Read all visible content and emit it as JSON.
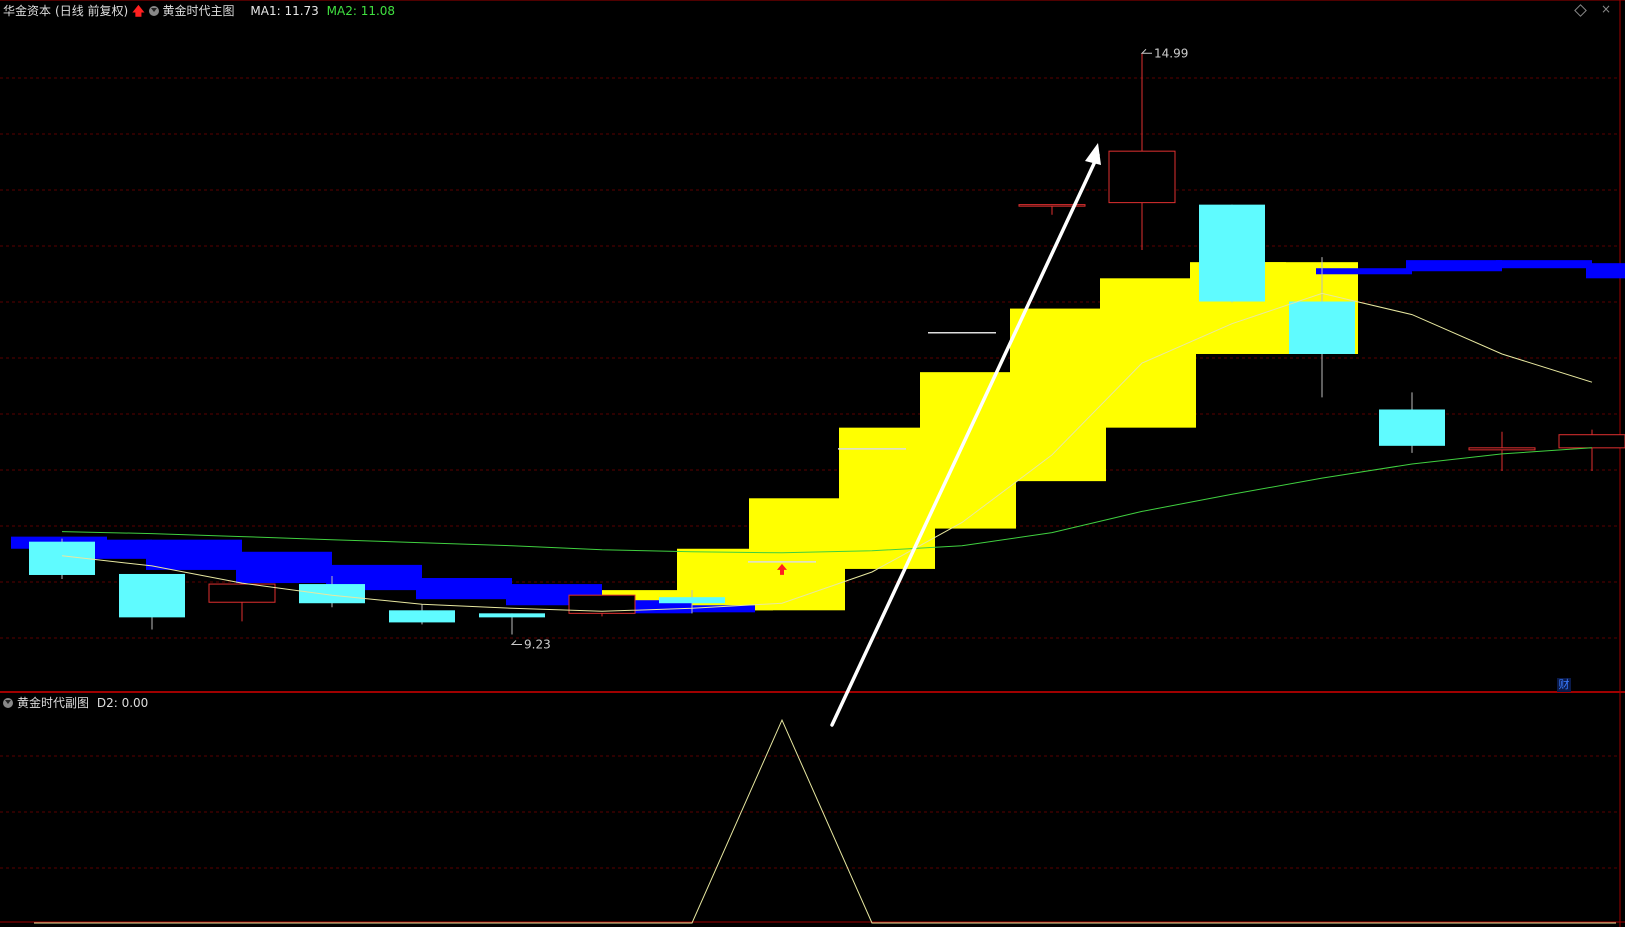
{
  "header": {
    "stock_name": "华金资本",
    "period_label": "(日线 前复权)",
    "main_indicator": "黄金时代主图",
    "ma1_label": "MA1: 11.73",
    "ma2_label": "MA2: 11.08"
  },
  "sub_header": {
    "indicator": "黄金时代副图",
    "d2_label": "D2: 0.00"
  },
  "side_badge": "财",
  "colors": {
    "background": "#000000",
    "grid": "#5a0000",
    "separator": "#a00000",
    "up_candle": "#e03030",
    "down_candle": "#5ffbff",
    "ma1_line": "#e8e8a0",
    "ma2_line": "#40d040",
    "yellow_band": "#ffff00",
    "blue_band": "#0000ff",
    "sub_line": "#e8e8a0",
    "ma1_text": "#e8e8e8",
    "ma2_text": "#40e040",
    "annotation_arrow": "#ffffff",
    "signal_arrow": "#ff2020"
  },
  "chart_data": {
    "type": "candlestick",
    "ylim": [
      8.7,
      15.3
    ],
    "candles": [
      {
        "o": 10.15,
        "h": 10.18,
        "l": 9.78,
        "c": 9.82
      },
      {
        "o": 9.83,
        "h": 9.83,
        "l": 9.28,
        "c": 9.4
      },
      {
        "o": 9.55,
        "h": 9.73,
        "l": 9.36,
        "c": 9.73
      },
      {
        "o": 9.73,
        "h": 9.81,
        "l": 9.5,
        "c": 9.54
      },
      {
        "o": 9.47,
        "h": 9.53,
        "l": 9.33,
        "c": 9.35
      },
      {
        "o": 9.44,
        "h": 9.44,
        "l": 9.23,
        "c": 9.4
      },
      {
        "o": 9.44,
        "h": 9.44,
        "l": 9.41,
        "c": 9.62
      },
      {
        "o": 9.6,
        "h": 9.67,
        "l": 9.44,
        "c": 9.54
      },
      {
        "o": 9.95,
        "h": 9.95,
        "l": 9.95,
        "c": 9.95
      },
      {
        "o": 11.07,
        "h": 11.07,
        "l": 11.07,
        "c": 11.07
      },
      {
        "o": 12.22,
        "h": 12.22,
        "l": 12.22,
        "c": 12.22
      },
      {
        "o": 13.49,
        "h": 13.49,
        "l": 13.39,
        "c": 13.49
      },
      {
        "o": 13.51,
        "h": 14.99,
        "l": 13.04,
        "c": 14.02
      },
      {
        "o": 13.49,
        "h": 13.49,
        "l": 12.52,
        "c": 12.53
      },
      {
        "o": 12.53,
        "h": 12.97,
        "l": 11.58,
        "c": 12.01
      },
      {
        "o": 11.46,
        "h": 11.63,
        "l": 11.03,
        "c": 11.1
      },
      {
        "o": 11.06,
        "h": 11.24,
        "l": 10.85,
        "c": 11.08
      },
      {
        "o": 11.08,
        "h": 11.26,
        "l": 10.85,
        "c": 11.21
      }
    ],
    "ma1": [
      10.01,
      9.91,
      9.74,
      9.62,
      9.53,
      9.49,
      9.46,
      9.49,
      9.54,
      9.85,
      10.34,
      11.01,
      11.92,
      12.31,
      12.61,
      12.4,
      12.01,
      11.73
    ],
    "ma2": [
      10.25,
      10.23,
      10.2,
      10.17,
      10.14,
      10.11,
      10.07,
      10.05,
      10.04,
      10.06,
      10.11,
      10.24,
      10.45,
      10.62,
      10.78,
      10.92,
      11.02,
      11.08
    ],
    "bands": [
      {
        "color": "yellow",
        "range": [
          9.51,
          9.67
        ]
      },
      {
        "color": "yellow",
        "range": [
          9.47,
          10.08
        ]
      },
      {
        "color": "yellow",
        "range": [
          9.47,
          10.58
        ]
      },
      {
        "color": "yellow",
        "range": [
          9.88,
          11.28
        ]
      },
      {
        "color": "yellow",
        "range": [
          10.28,
          11.83
        ]
      },
      {
        "color": "yellow",
        "range": [
          10.75,
          12.46
        ]
      },
      {
        "color": "yellow",
        "range": [
          11.28,
          12.76
        ]
      },
      {
        "color": "yellow",
        "range": [
          12.01,
          12.92
        ]
      },
      {
        "color": "yellow",
        "range": [
          12.01,
          12.92
        ]
      },
      {
        "color": "blue",
        "range": [
          12.8,
          12.86
        ]
      },
      {
        "color": "blue",
        "range": [
          12.83,
          12.94
        ]
      },
      {
        "color": "blue",
        "range": [
          12.86,
          12.94
        ]
      },
      {
        "color": "blue",
        "range": [
          12.76,
          12.91
        ]
      },
      {
        "color": "blue",
        "range": [
          12.7,
          12.89
        ]
      },
      {
        "color": "blue",
        "range": [
          10.08,
          10.2
        ]
      },
      {
        "color": "blue",
        "range": [
          9.98,
          10.17
        ]
      },
      {
        "color": "blue",
        "range": [
          9.87,
          10.17
        ]
      },
      {
        "color": "blue",
        "range": [
          9.74,
          10.05
        ]
      },
      {
        "color": "blue",
        "range": [
          9.67,
          9.92
        ]
      },
      {
        "color": "blue",
        "range": [
          9.58,
          9.79
        ]
      },
      {
        "color": "blue",
        "range": [
          9.52,
          9.73
        ]
      },
      {
        "color": "blue",
        "range": [
          9.44,
          9.57
        ]
      },
      {
        "color": "blue",
        "range": [
          9.45,
          9.52
        ]
      }
    ],
    "signal_arrow_bar": 8,
    "high_label": "14.99",
    "low_label": "9.23",
    "sub_indicator": {
      "name": "黄金时代副图",
      "values": [
        0,
        0,
        0,
        0,
        0,
        0,
        0,
        0,
        1,
        0,
        0,
        0,
        0,
        0,
        0,
        0,
        0,
        0
      ],
      "ylim": [
        0,
        1.05
      ]
    }
  }
}
